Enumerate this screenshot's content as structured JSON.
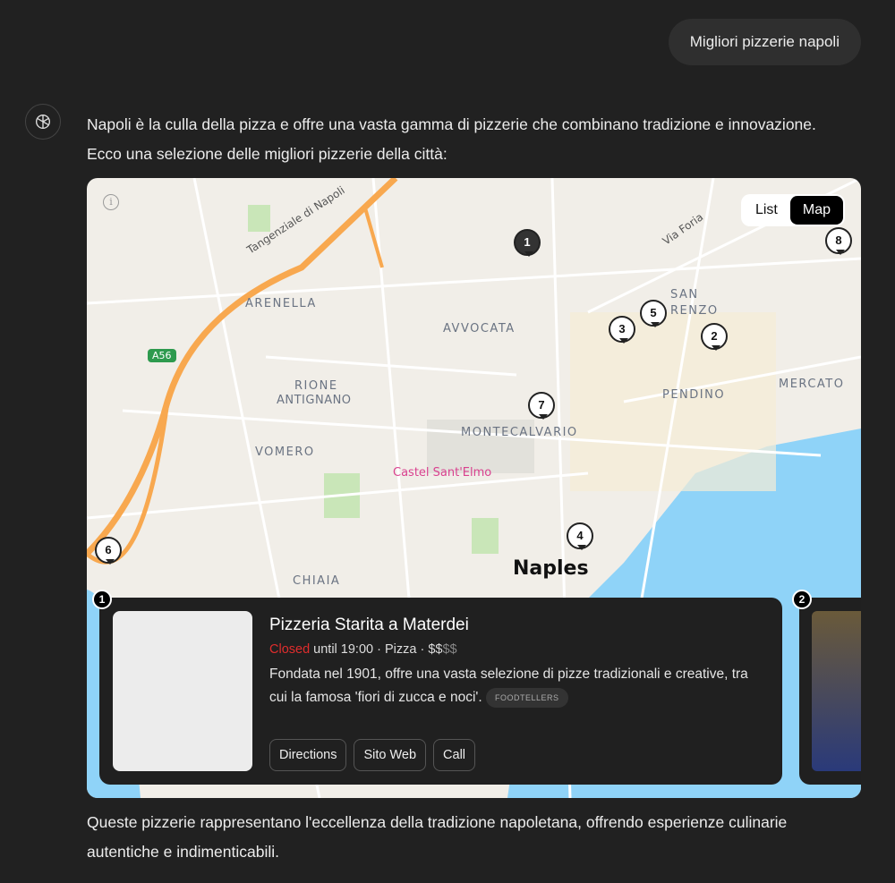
{
  "user_message": "Migliori pizzerie napoli",
  "intro": "Napoli è la culla della pizza e offre una vasta gamma di pizzerie che combinano tradizione e innovazione. Ecco una selezione delle migliori pizzerie della città:",
  "outro": "Queste pizzerie rappresentano l'eccellenza della tradizione napoletana, offrendo esperienze culinarie autentiche e indimenticabili.",
  "map": {
    "toggle": {
      "list": "List",
      "map": "Map",
      "active": "Map"
    },
    "info_icon": "i",
    "labels": {
      "tangenziale": "Tangenziale di Napoli",
      "via_foria": "Via Foria",
      "arenella": "ARENELLA",
      "avvocata": "AVVOCATA",
      "san": "SAN",
      "renzo": "RENZO",
      "a56": "A56",
      "rione": "RIONE",
      "antignano": "ANTIGNANO",
      "pendino": "PENDINO",
      "mercato": "MERCATO",
      "montecalvario": "MONTECALVARIO",
      "vomero": "VOMERO",
      "castel": "Castel Sant'Elmo",
      "chiaia": "CHIAIA",
      "naples": "Naples"
    },
    "pins": [
      "1",
      "2",
      "3",
      "4",
      "5",
      "6",
      "7",
      "8"
    ],
    "colors": {
      "land": "#f1eee8",
      "water": "#8fd3f8",
      "highway": "#f8a84f",
      "park": "#c9e6b8"
    }
  },
  "card": {
    "number": "1",
    "title": "Pizzeria Starita a Materdei",
    "status": "Closed",
    "status_color": "#e02d2d",
    "hours": " until 19:00 · Pizza · ",
    "price_active": "$$",
    "price_inactive": "$$",
    "description": "Fondata nel 1901, offre una vasta selezione di pizze tradizionali e creative, tra cui la famosa 'fiori di zucca e noci'.",
    "source": "FOODTELLERS",
    "buttons": {
      "directions": "Directions",
      "website": "Sito Web",
      "call": "Call"
    }
  },
  "card_next": {
    "number": "2"
  }
}
